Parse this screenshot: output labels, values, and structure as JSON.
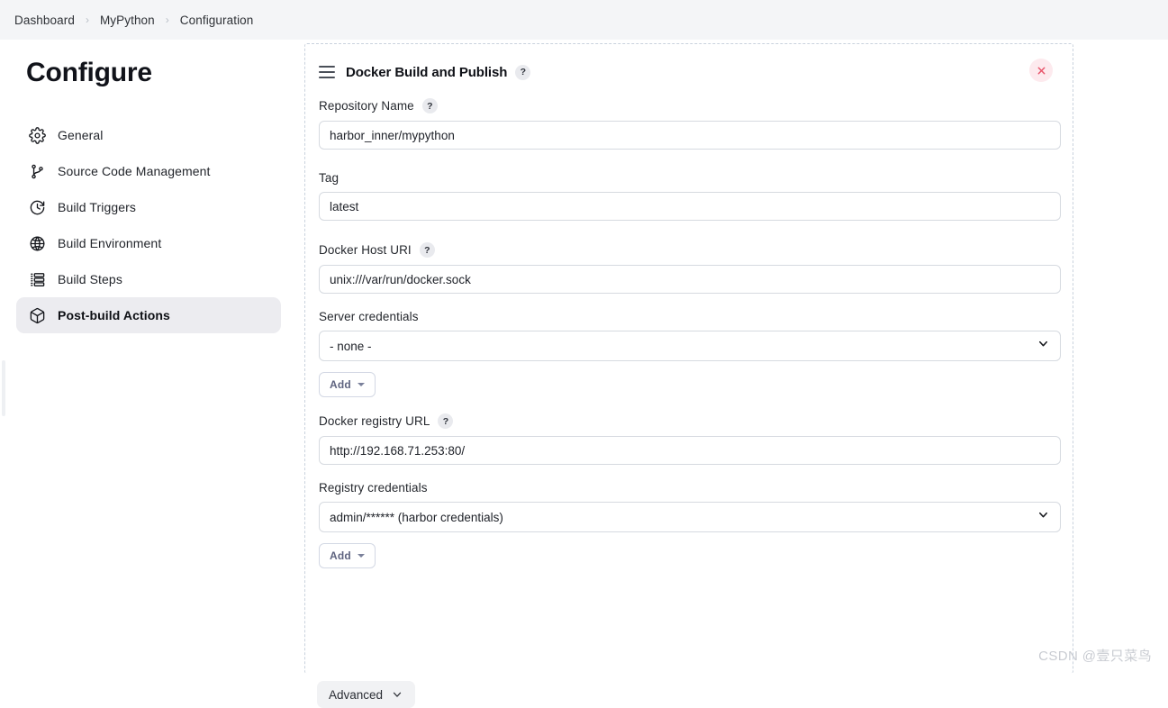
{
  "breadcrumb": {
    "items": [
      {
        "label": "Dashboard"
      },
      {
        "label": "MyPython"
      },
      {
        "label": "Configuration"
      }
    ],
    "separator": "›"
  },
  "ghost_text_above": "Advanced",
  "sidebar": {
    "title": "Configure",
    "items": [
      {
        "label": "General",
        "icon": "gear-icon",
        "active": false
      },
      {
        "label": "Source Code Management",
        "icon": "branch-icon",
        "active": false
      },
      {
        "label": "Build Triggers",
        "icon": "clock-icon",
        "active": false
      },
      {
        "label": "Build Environment",
        "icon": "globe-icon",
        "active": false
      },
      {
        "label": "Build Steps",
        "icon": "list-icon",
        "active": false
      },
      {
        "label": "Post-build Actions",
        "icon": "package-icon",
        "active": true
      }
    ]
  },
  "panel": {
    "title": "Docker Build and Publish",
    "help_glyph": "?",
    "drag_handle_icon": "drag-handle-icon",
    "close_icon": "close-icon",
    "fields": {
      "repository_name": {
        "label": "Repository Name",
        "value": "harbor_inner/mypython",
        "has_help": true
      },
      "tag": {
        "label": "Tag",
        "value": "latest",
        "has_help": false
      },
      "docker_host_uri": {
        "label": "Docker Host URI",
        "value": "unix:///var/run/docker.sock",
        "has_help": true
      },
      "server_credentials": {
        "label": "Server credentials",
        "value": "- none -",
        "has_help": false,
        "add_label": "Add"
      },
      "docker_registry_url": {
        "label": "Docker registry URL",
        "value": "http://192.168.71.253:80/",
        "has_help": true
      },
      "registry_credentials": {
        "label": "Registry credentials",
        "value": "admin/****** (harbor credentials)",
        "has_help": false,
        "add_label": "Add"
      }
    },
    "advanced_label": "Advanced"
  },
  "watermark": "CSDN @壹只菜鸟",
  "colors": {
    "breadcrumb_bg": "#f4f5f7",
    "active_nav_bg": "#ececf0",
    "panel_dash_border": "#c9d2dd",
    "input_border": "#d6dae0",
    "close_bg": "#fdeaee",
    "close_fg": "#e8546a",
    "add_text": "#5f6480"
  }
}
